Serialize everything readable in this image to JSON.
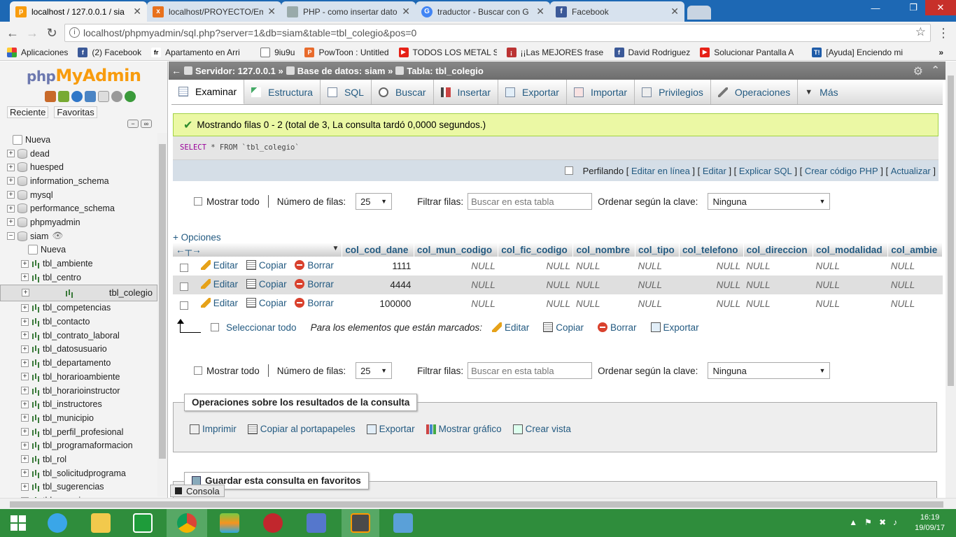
{
  "browser": {
    "tabs": [
      {
        "title": "localhost / 127.0.0.1 / sia",
        "icon": "phpmyadmin-icon",
        "active": true
      },
      {
        "title": "localhost/PROYECTO/Em",
        "icon": "xampp-icon",
        "active": false
      },
      {
        "title": "PHP - como insertar dato",
        "icon": "page-icon",
        "active": false
      },
      {
        "title": "traductor - Buscar con G",
        "icon": "google-icon",
        "active": false
      },
      {
        "title": "Facebook",
        "icon": "facebook-icon",
        "active": false
      }
    ],
    "url": "localhost/phpmyadmin/sql.php?server=1&db=siam&table=tbl_colegio&pos=0",
    "bookmarks": [
      {
        "label": "Aplicaciones",
        "icon": "apps-icon"
      },
      {
        "label": "(2) Facebook",
        "icon": "facebook-icon"
      },
      {
        "label": "Apartamento en Arri",
        "icon": "fr-icon"
      },
      {
        "label": "9iu9u",
        "icon": "page-icon"
      },
      {
        "label": "PowToon : Untitled",
        "icon": "pt-icon"
      },
      {
        "label": "TODOS LOS METAL S",
        "icon": "youtube-icon"
      },
      {
        "label": "¡¡Las MEJORES frase",
        "icon": "quote-icon"
      },
      {
        "label": "David Rodriguez",
        "icon": "facebook-icon"
      },
      {
        "label": "Solucionar Pantalla A",
        "icon": "youtube-icon"
      },
      {
        "label": "[Ayuda] Enciendo mi",
        "icon": "t-icon"
      }
    ]
  },
  "sidebar": {
    "logo_php": "php",
    "logo_ma": "MyAdmin",
    "tab_recent": "Reciente",
    "tab_favorites": "Favoritas",
    "tree": [
      {
        "label": "Nueva",
        "kind": "new",
        "level": 0
      },
      {
        "label": "dead",
        "kind": "db",
        "level": 0
      },
      {
        "label": "huesped",
        "kind": "db",
        "level": 0
      },
      {
        "label": "information_schema",
        "kind": "db",
        "level": 0
      },
      {
        "label": "mysql",
        "kind": "db",
        "level": 0
      },
      {
        "label": "performance_schema",
        "kind": "db",
        "level": 0
      },
      {
        "label": "phpmyadmin",
        "kind": "db",
        "level": 0
      },
      {
        "label": "siam",
        "kind": "db-open",
        "level": 0
      },
      {
        "label": "Nueva",
        "kind": "new",
        "level": 1
      },
      {
        "label": "tbl_ambiente",
        "kind": "table",
        "level": 1
      },
      {
        "label": "tbl_centro",
        "kind": "table",
        "level": 1
      },
      {
        "label": "tbl_colegio",
        "kind": "table",
        "level": 1,
        "selected": true
      },
      {
        "label": "tbl_competencias",
        "kind": "table",
        "level": 1
      },
      {
        "label": "tbl_contacto",
        "kind": "table",
        "level": 1
      },
      {
        "label": "tbl_contrato_laboral",
        "kind": "table",
        "level": 1
      },
      {
        "label": "tbl_datosusuario",
        "kind": "table",
        "level": 1
      },
      {
        "label": "tbl_departamento",
        "kind": "table",
        "level": 1
      },
      {
        "label": "tbl_horarioambiente",
        "kind": "table",
        "level": 1
      },
      {
        "label": "tbl_horarioinstructor",
        "kind": "table",
        "level": 1
      },
      {
        "label": "tbl_instructores",
        "kind": "table",
        "level": 1
      },
      {
        "label": "tbl_municipio",
        "kind": "table",
        "level": 1
      },
      {
        "label": "tbl_perfil_profesional",
        "kind": "table",
        "level": 1
      },
      {
        "label": "tbl_programaformacion",
        "kind": "table",
        "level": 1
      },
      {
        "label": "tbl_rol",
        "kind": "table",
        "level": 1
      },
      {
        "label": "tbl_solicitudprograma",
        "kind": "table",
        "level": 1
      },
      {
        "label": "tbl_sugerencias",
        "kind": "table",
        "level": 1
      },
      {
        "label": "tbl_usuario",
        "kind": "table",
        "level": 1
      }
    ]
  },
  "breadcrumb": {
    "server": "Servidor: 127.0.0.1 »",
    "database": "Base de datos: siam »",
    "table": "Tabla: tbl_colegio"
  },
  "menu": [
    {
      "label": "Examinar",
      "active": true
    },
    {
      "label": "Estructura"
    },
    {
      "label": "SQL"
    },
    {
      "label": "Buscar"
    },
    {
      "label": "Insertar"
    },
    {
      "label": "Exportar"
    },
    {
      "label": "Importar"
    },
    {
      "label": "Privilegios"
    },
    {
      "label": "Operaciones"
    },
    {
      "label": "Más"
    }
  ],
  "message": "Mostrando filas 0 - 2 (total de 3, La consulta tardó 0,0000 segundos.)",
  "sql": {
    "keyword": "SELECT",
    "rest": " * FROM `tbl_colegio`"
  },
  "profiling": {
    "label": "Perfilando",
    "links": [
      "Editar en línea",
      "Editar",
      "Explicar SQL",
      "Crear código PHP",
      "Actualizar"
    ]
  },
  "nav": {
    "show_all": "Mostrar todo",
    "rows_label": "Número de filas:",
    "rows_value": "25",
    "filter_label": "Filtrar filas:",
    "filter_placeholder": "Buscar en esta tabla",
    "sort_label": "Ordenar según la clave:",
    "sort_value": "Ninguna"
  },
  "options_link": "+ Opciones",
  "table": {
    "columns": [
      "col_cod_dane",
      "col_mun_codigo",
      "col_fic_codigo",
      "col_nombre",
      "col_tipo",
      "col_telefono",
      "col_direccion",
      "col_modalidad",
      "col_ambie"
    ],
    "row_actions": {
      "edit": "Editar",
      "copy": "Copiar",
      "delete": "Borrar"
    },
    "rows": [
      [
        "1111",
        "NULL",
        "NULL",
        "NULL",
        "NULL",
        "NULL",
        "NULL",
        "NULL",
        "NULL"
      ],
      [
        "4444",
        "NULL",
        "NULL",
        "NULL",
        "NULL",
        "NULL",
        "NULL",
        "NULL",
        "NULL"
      ],
      [
        "100000",
        "NULL",
        "NULL",
        "NULL",
        "NULL",
        "NULL",
        "NULL",
        "NULL",
        "NULL"
      ]
    ]
  },
  "bulk": {
    "select_all": "Seleccionar todo",
    "marked_label": "Para los elementos que están marcados:",
    "edit": "Editar",
    "copy": "Copiar",
    "delete": "Borrar",
    "export": "Exportar"
  },
  "ops": {
    "title": "Operaciones sobre los resultados de la consulta",
    "links": [
      "Imprimir",
      "Copiar al portapapeles",
      "Exportar",
      "Mostrar gráfico",
      "Crear vista"
    ]
  },
  "favorites_title": "Guardar esta consulta en favoritos",
  "console_label": "Consola",
  "clock": {
    "time": "16:19",
    "date": "19/09/17"
  }
}
